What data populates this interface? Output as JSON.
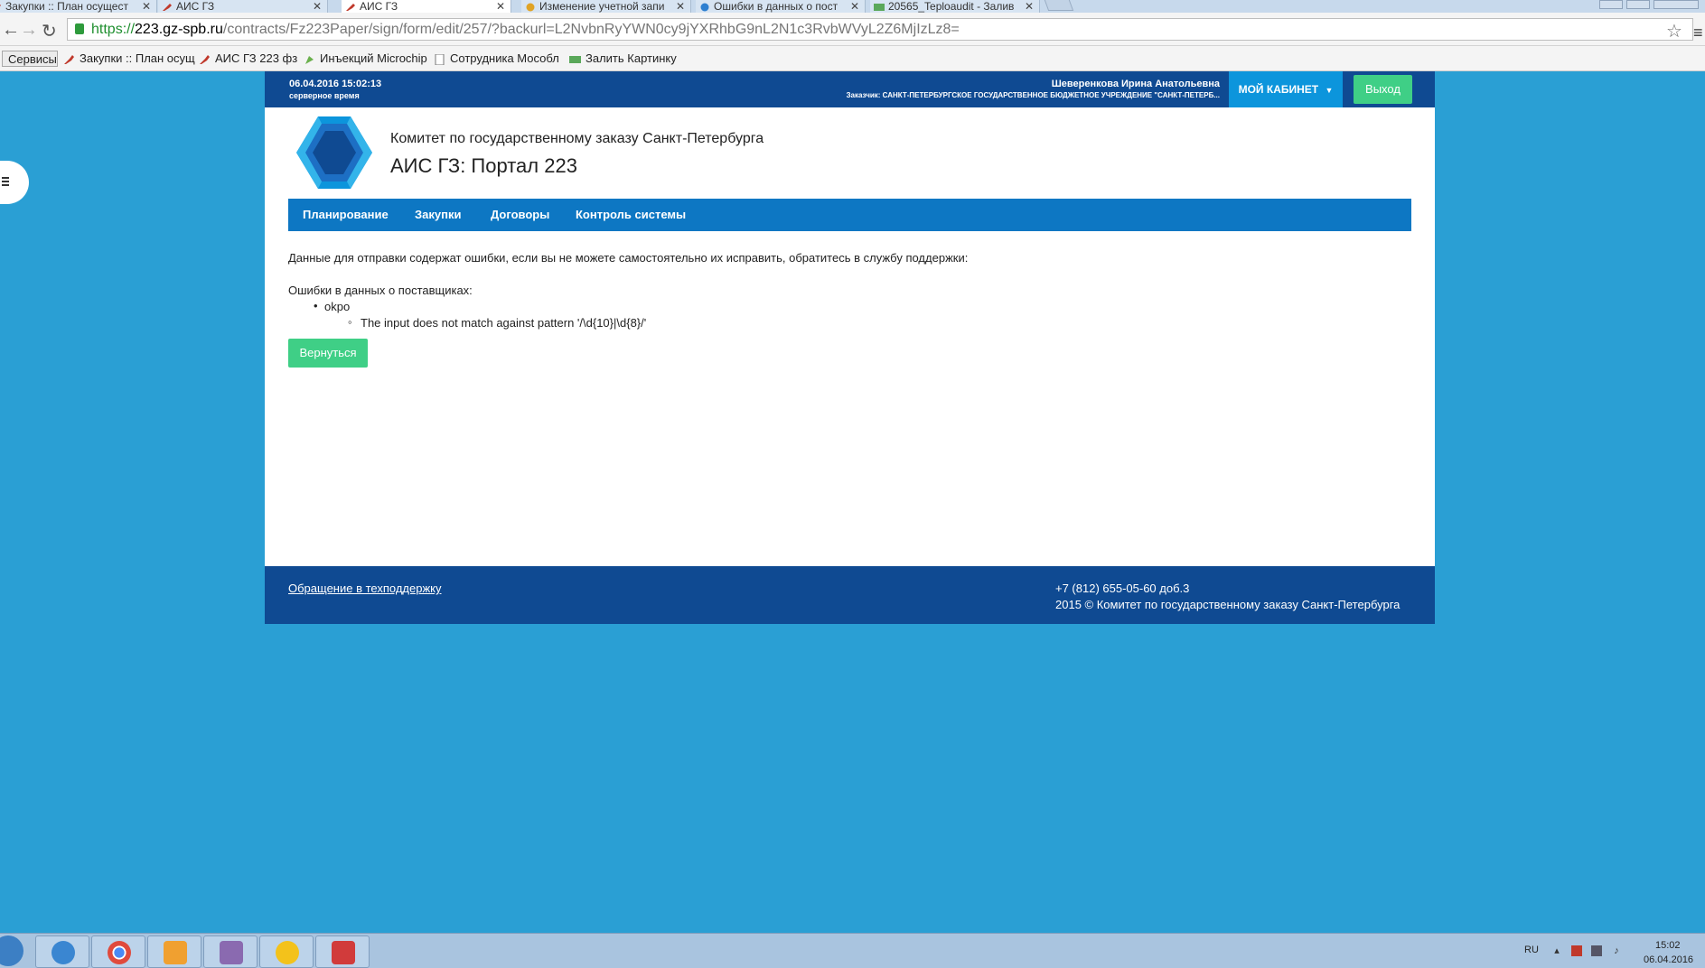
{
  "browser": {
    "tabs": [
      {
        "title": "Закупки :: План осущест"
      },
      {
        "title": "АИС ГЗ"
      },
      {
        "title": "АИС ГЗ"
      },
      {
        "title": "Изменение учетной запи"
      },
      {
        "title": "Ошибки в данных о пост"
      },
      {
        "title": "20565_Teploaudit - Залив"
      }
    ],
    "url_scheme": "https://",
    "url_host": "223.gz-spb.ru",
    "url_path": "/contracts/Fz223Paper/sign/form/edit/257/?backurl=L2NvbnRyYWN0cy9jYXRhbG9nL2N1c3RvbWVyL2Z6MjIzLz8=",
    "bookmarks": [
      {
        "label": "Сервисы"
      },
      {
        "label": "Закупки :: План осущ"
      },
      {
        "label": "АИС ГЗ 223 фз"
      },
      {
        "label": "Инъекций Microchip"
      },
      {
        "label": "Сотрудника Мособл"
      },
      {
        "label": "Залить Картинку"
      }
    ]
  },
  "header": {
    "date": "06.04.2016 15:02:13",
    "date_sub": "серверное время",
    "user_name": "Шеверенкова Ирина Анатольевна",
    "customer": "Заказчик: САНКТ-ПЕТЕРБУРГСКОЕ ГОСУДАРСТВЕННОЕ БЮДЖЕТНОЕ УЧРЕЖДЕНИЕ \"САНКТ-ПЕТЕРБ...",
    "cabinet_label": "МОЙ КАБИНЕТ",
    "exit_label": "Выход",
    "org_name": "Комитет по государственному заказу Санкт-Петербурга",
    "portal_name": "АИС ГЗ: Портал 223"
  },
  "menu": [
    {
      "label": "Планирование"
    },
    {
      "label": "Закупки"
    },
    {
      "label": "Договоры"
    },
    {
      "label": "Контроль системы"
    }
  ],
  "content": {
    "message": "Данные для отправки содержат ошибки, если вы не можете самостоятельно их исправить, обратитесь в службу поддержки:",
    "errors_title": "Ошибки в данных о поставщиках:",
    "error_field": "okpo",
    "error_detail": "The input does not match against pattern '/\\d{10}|\\d{8}/'",
    "back_label": "Вернуться"
  },
  "footer": {
    "support_link": "Обращение в техподдержку",
    "phone": "+7 (812) 655-05-60 доб.3",
    "copyright": "2015 © Комитет по государственному заказу Санкт-Петербурга"
  },
  "taskbar": {
    "lang": "RU",
    "time": "15:02",
    "date": "06.04.2016"
  },
  "colors": {
    "page_background": "#2a9fd4",
    "header_blue": "#0f4a92",
    "menu_blue": "#0d77c3",
    "cabinet_blue": "#0c95dc",
    "button_green": "#3fcf86"
  }
}
